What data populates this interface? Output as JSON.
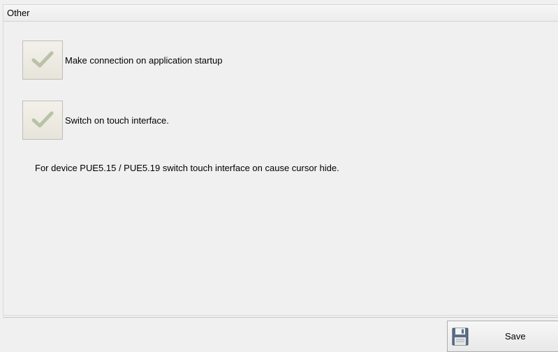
{
  "panel": {
    "title": "Other"
  },
  "options": [
    {
      "label": "Make connection on application startup",
      "checked": true,
      "icon": "checkmark-icon"
    },
    {
      "label": "Switch on touch interface.",
      "checked": true,
      "icon": "checkmark-icon"
    }
  ],
  "note": "For device PUE5.15 / PUE5.19 switch touch interface on cause cursor hide.",
  "footer": {
    "save_label": "Save",
    "save_icon": "floppy-disk-icon"
  },
  "colors": {
    "checkmark": "#b9c2a6",
    "background": "#f0f0f0"
  }
}
